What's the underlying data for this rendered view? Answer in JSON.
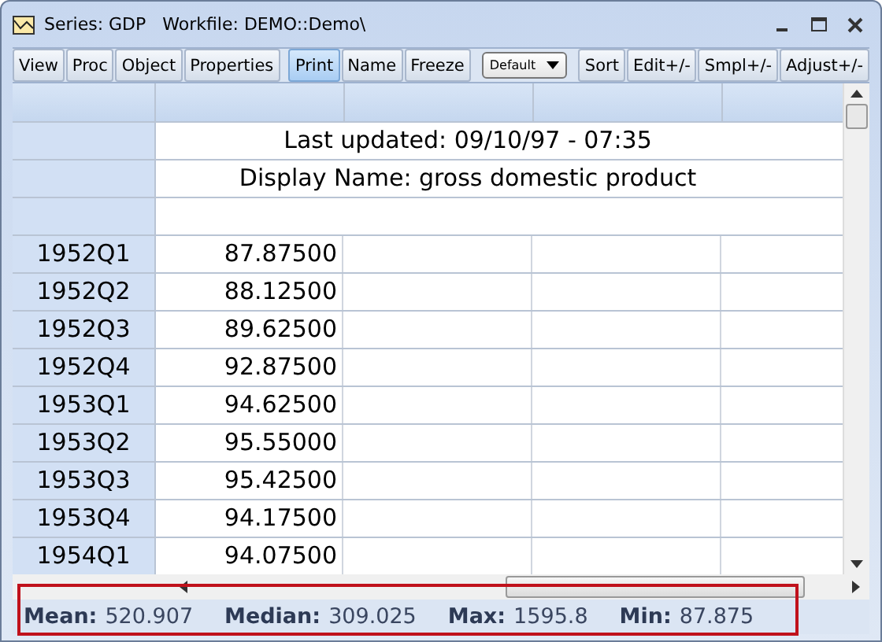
{
  "window": {
    "title": "Series: GDP   Workfile: DEMO::Demo\\"
  },
  "toolbar": [
    {
      "kind": "button",
      "label": "View",
      "selected": false
    },
    {
      "kind": "button",
      "label": "Proc",
      "selected": false
    },
    {
      "kind": "button",
      "label": "Object",
      "selected": false
    },
    {
      "kind": "button",
      "label": "Properties",
      "selected": false
    },
    {
      "kind": "separator"
    },
    {
      "kind": "button",
      "label": "Print",
      "selected": true
    },
    {
      "kind": "button",
      "label": "Name",
      "selected": false
    },
    {
      "kind": "button",
      "label": "Freeze",
      "selected": false
    },
    {
      "kind": "dropdown",
      "label": "Default"
    },
    {
      "kind": "button",
      "label": "Sort",
      "selected": false
    },
    {
      "kind": "button",
      "label": "Edit+/-",
      "selected": false
    },
    {
      "kind": "button",
      "label": "Smpl+/-",
      "selected": false
    },
    {
      "kind": "button",
      "label": "Adjust+/-",
      "selected": false
    }
  ],
  "table": {
    "info_rows": [
      "Last updated: 09/10/97 - 07:35",
      "Display Name: gross domestic product"
    ],
    "rows": [
      {
        "label": "1952Q1",
        "value": "87.87500"
      },
      {
        "label": "1952Q2",
        "value": "88.12500"
      },
      {
        "label": "1952Q3",
        "value": "89.62500"
      },
      {
        "label": "1952Q4",
        "value": "92.87500"
      },
      {
        "label": "1953Q1",
        "value": "94.62500"
      },
      {
        "label": "1953Q2",
        "value": "95.55000"
      },
      {
        "label": "1953Q3",
        "value": "95.42500"
      },
      {
        "label": "1953Q4",
        "value": "94.17500"
      },
      {
        "label": "1954Q1",
        "value": "94.07500"
      }
    ]
  },
  "status_bar": [
    {
      "label": "Mean:",
      "value": "520.907"
    },
    {
      "label": "Median:",
      "value": "309.025"
    },
    {
      "label": "Max:",
      "value": "1595.8"
    },
    {
      "label": "Min:",
      "value": "87.875"
    }
  ]
}
